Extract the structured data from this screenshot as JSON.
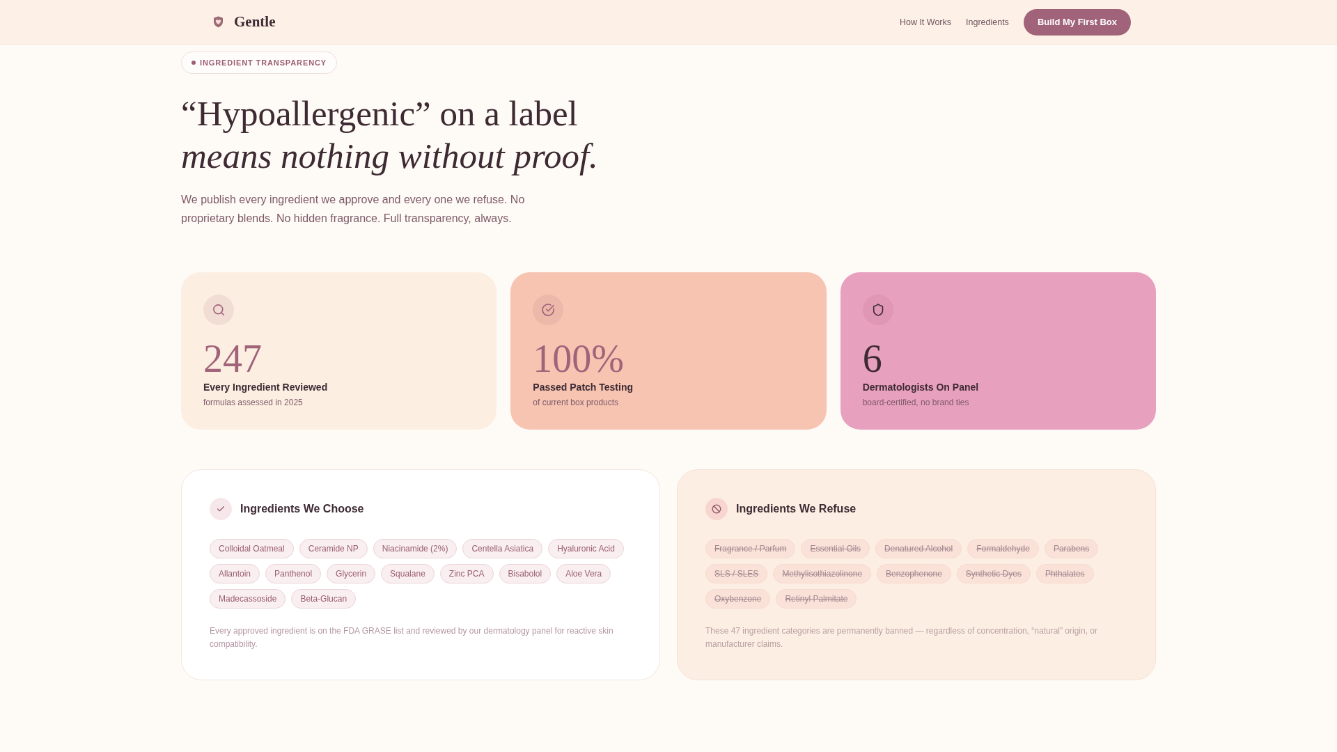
{
  "header": {
    "brand": "Gentle",
    "nav_links": [
      "How It Works",
      "Ingredients"
    ],
    "cta_button": "Build My First Box"
  },
  "hero": {
    "badge": "INGREDIENT TRANSPARENCY",
    "headline": "“Hypoallergenic” on a label *means nothing without proof.*",
    "intro": "We publish every ingredient we approve and every one we refuse. No proprietary blends. No hidden fragrance. Full transparency, always."
  },
  "stats": [
    {
      "kind": "review",
      "color": "#fdeee2",
      "value": "247",
      "label": "Every Ingredient Reviewed",
      "note": "formulas assessed in 2025"
    },
    {
      "kind": "testing",
      "color": "#f7c4b2",
      "value": "100%",
      "label": "Passed Patch Testing",
      "note": "of current box products"
    },
    {
      "kind": "panel",
      "color": "#e8a0bf",
      "value": "6",
      "label": "Dermatologists On Panel",
      "note": "board-certified, no brand ties"
    }
  ],
  "ingredient_panels": [
    {
      "kind": "approved",
      "title": "Ingredients We Choose",
      "ingredients": [
        "Colloidal Oatmeal",
        "Ceramide NP",
        "Niacinamide (2%)",
        "Centella Asiatica",
        "Hyaluronic Acid",
        "Allantoin",
        "Panthenol",
        "Glycerin",
        "Squalane",
        "Zinc PCA",
        "Bisabolol",
        "Aloe Vera",
        "Madecassoside",
        "Beta-Glucan"
      ],
      "footnote": "Every approved ingredient is on the FDA GRASE list and reviewed by our dermatology panel for reactive skin compatibility."
    },
    {
      "kind": "refused",
      "title": "Ingredients We Refuse",
      "ingredients": [
        "Fragrance / Parfum",
        "Essential Oils",
        "Denatured Alcohol",
        "Formaldehyde",
        "Parabens",
        "SLS / SLES",
        "Methylisothiazolinone",
        "Benzophenone",
        "Synthetic Dyes",
        "Phthalates",
        "Oxybenzone",
        "Retinyl Palmitate"
      ],
      "footnote": "These 47 ingredient categories are permanently banned — regardless of concentration, “natural” origin, or manufacturer claims."
    }
  ]
}
